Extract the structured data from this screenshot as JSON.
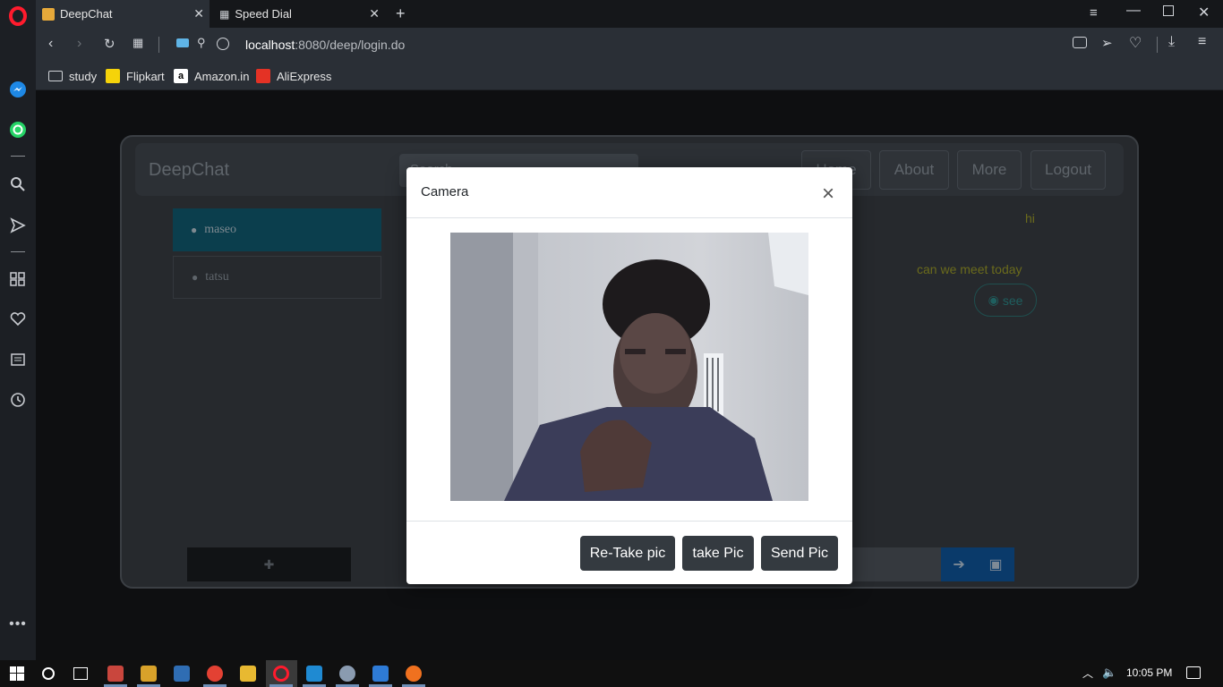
{
  "browser": {
    "tabs": [
      {
        "label": "DeepChat",
        "active": true
      },
      {
        "label": "Speed Dial",
        "active": false
      }
    ],
    "address": {
      "host": "localhost",
      "rest": ":8080/deep/login.do"
    },
    "bookmarks": [
      {
        "label": "study",
        "icon": "folder-icon"
      },
      {
        "label": "Flipkart",
        "icon": "flipkart-icon",
        "color": "#f5d30a"
      },
      {
        "label": "Amazon.in",
        "icon": "amazon-icon",
        "color": "#ffffff"
      },
      {
        "label": "AliExpress",
        "icon": "aliexpress-icon",
        "color": "#e43225"
      }
    ]
  },
  "app": {
    "brand": "DeepChat",
    "search_placeholder": "Search",
    "nav": {
      "home": "Home",
      "about": "About",
      "more": "More",
      "logout": "Logout"
    },
    "contacts": [
      {
        "name": "maseo",
        "active": true
      },
      {
        "name": "tatsu",
        "active": false
      }
    ],
    "messages": [
      {
        "text": "hi"
      },
      {
        "text": "can we meet today"
      }
    ],
    "see_label": "see"
  },
  "modal": {
    "title": "Camera",
    "close": "×",
    "buttons": {
      "retake": "Re-Take pic",
      "take": "take Pic",
      "send": "Send Pic"
    }
  },
  "taskbar": {
    "time": "10:05 PM"
  },
  "colors": {
    "accent": "#0b4f63",
    "modal_btn": "#343a40",
    "msg": "#6b6b1c"
  }
}
